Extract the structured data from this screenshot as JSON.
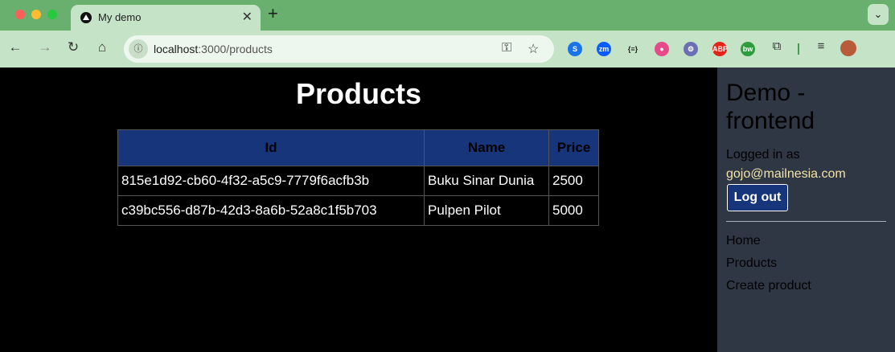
{
  "browser": {
    "tab_title": "My demo",
    "url_host": "localhost",
    "url_path": ":3000/products",
    "extensions": [
      {
        "name": "s-ext-icon",
        "label": "S",
        "color": "#1a73e8"
      },
      {
        "name": "zm-ext-icon",
        "label": "zm",
        "color": "#0b5cff"
      },
      {
        "name": "json-ext-icon",
        "label": "{≡}",
        "color": "#c5e3c6"
      },
      {
        "name": "circle-ext-icon",
        "label": "●",
        "color": "#e64a8a"
      },
      {
        "name": "spy-ext-icon",
        "label": "⚙",
        "color": "#6b6fb3"
      },
      {
        "name": "abp-ext-icon",
        "label": "ABP",
        "color": "#e2231a"
      },
      {
        "name": "bw-ext-icon",
        "label": "bw",
        "color": "#2e9b3c"
      }
    ]
  },
  "page": {
    "title": "Products"
  },
  "table": {
    "headers": [
      "Id",
      "Name",
      "Price"
    ],
    "rows": [
      [
        "815e1d92-cb60-4f32-a5c9-7779f6acfb3b",
        "Buku Sinar Dunia",
        "2500"
      ],
      [
        "c39bc556-d87b-42d3-8a6b-52a8c1f5b703",
        "Pulpen Pilot",
        "5000"
      ]
    ]
  },
  "sidebar": {
    "title": "Demo - frontend",
    "logged_in_label": "Logged in as",
    "email": "gojo@mailnesia.com",
    "logout_label": "Log out",
    "links": [
      "Home",
      "Products",
      "Create product"
    ]
  },
  "colors": {
    "accent": "#17357a",
    "sidebar_bg": "#2f3644",
    "chrome_green": "#69b06f"
  }
}
